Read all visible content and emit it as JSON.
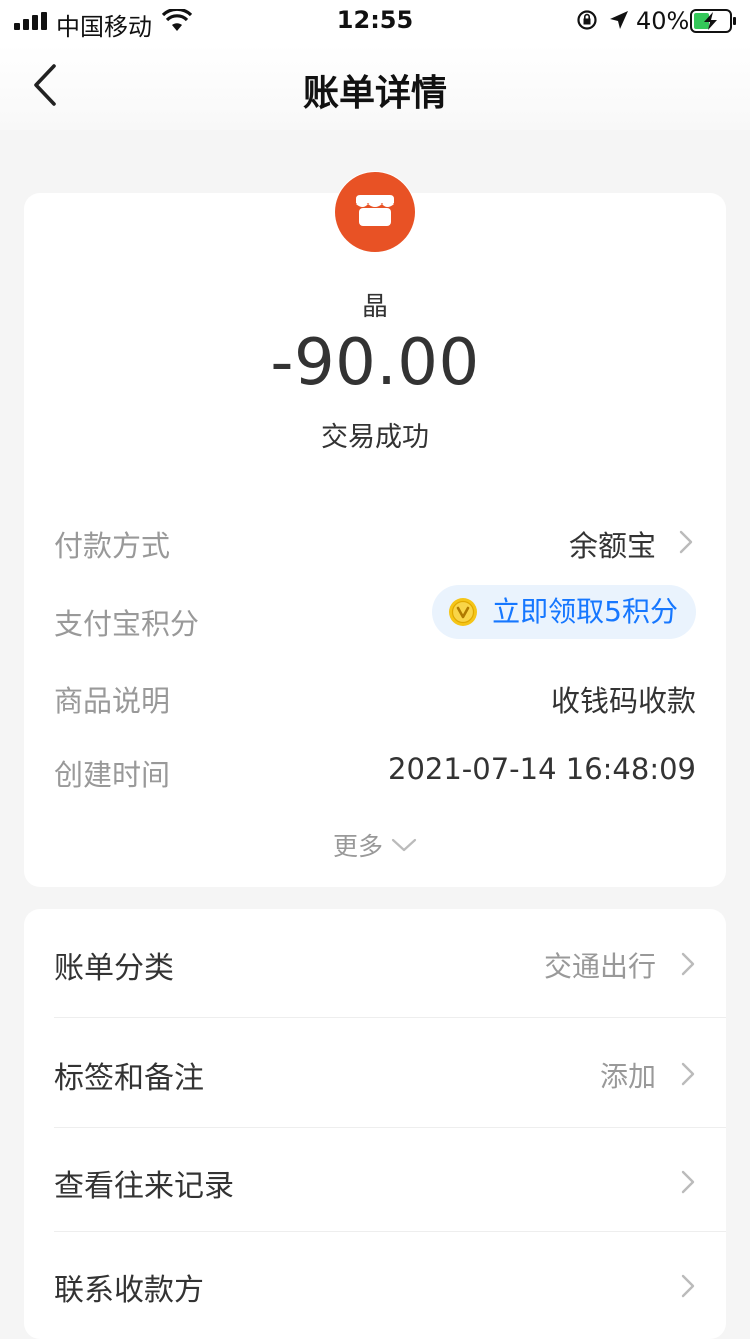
{
  "status_bar": {
    "carrier": "中国移动",
    "time": "12:55",
    "battery": "40%"
  },
  "nav": {
    "title": "账单详情"
  },
  "bill": {
    "merchant": "晶",
    "amount": "-90.00",
    "status": "交易成功",
    "brand_color": "#e85225"
  },
  "details": {
    "payment_method_label": "付款方式",
    "payment_method_value": "余额宝",
    "points_label": "支付宝积分",
    "points_button": "立即领取5积分",
    "goods_label": "商品说明",
    "goods_value": "收钱码收款",
    "created_label": "创建时间",
    "created_value": "2021-07-14 16:48:09",
    "more_label": "更多"
  },
  "actions": {
    "category_label": "账单分类",
    "category_value": "交通出行",
    "tags_label": "标签和备注",
    "tags_value": "添加",
    "history_label": "查看往来记录",
    "contact_label": "联系收款方"
  },
  "accent_color": "#1677ff"
}
